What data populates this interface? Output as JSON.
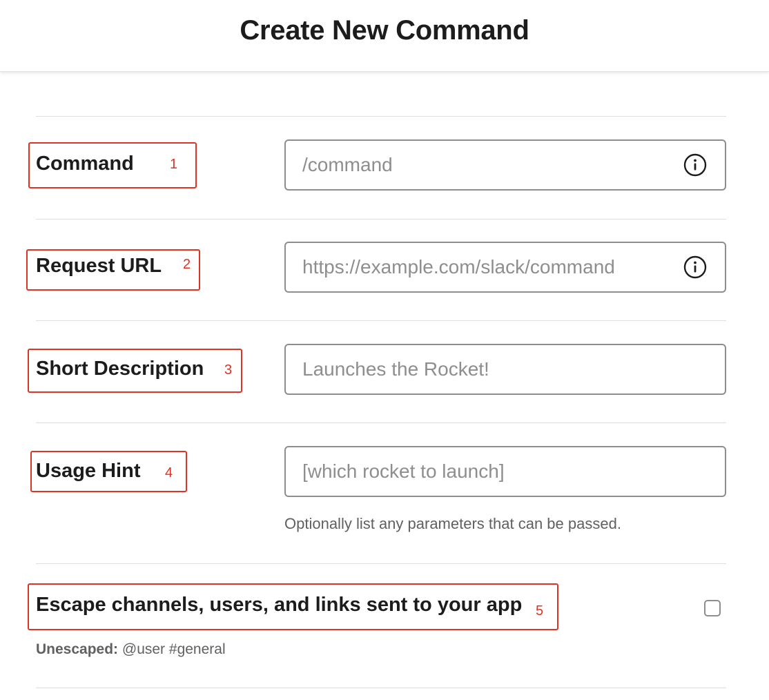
{
  "page": {
    "title": "Create New Command"
  },
  "form": {
    "command": {
      "label": "Command",
      "annotation": "1",
      "placeholder": "/command",
      "icon": "info-icon"
    },
    "request_url": {
      "label": "Request URL",
      "annotation": "2",
      "placeholder": "https://example.com/slack/command",
      "icon": "info-icon"
    },
    "short_description": {
      "label": "Short Description",
      "annotation": "3",
      "placeholder": "Launches the Rocket!"
    },
    "usage_hint": {
      "label": "Usage Hint",
      "annotation": "4",
      "placeholder": "[which rocket to launch]",
      "helper_text": "Optionally list any parameters that can be passed."
    },
    "escape": {
      "label": "Escape channels, users, and links sent to your app",
      "annotation": "5",
      "checked": false,
      "status_label": "Unescaped:",
      "status_value": " @user #general"
    }
  },
  "colors": {
    "annotation": "#dd3322",
    "input_border": "#8d8d8d",
    "placeholder": "#8e8e8e",
    "divider": "#dddddd"
  }
}
